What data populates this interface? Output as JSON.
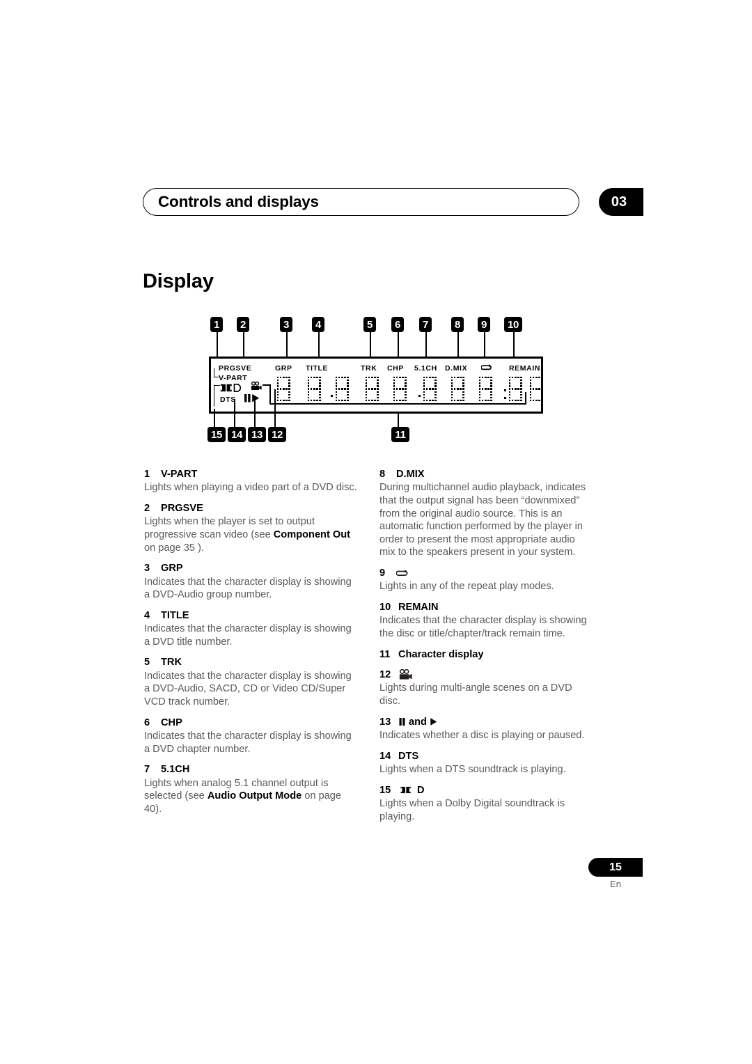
{
  "header": {
    "title": "Controls and displays",
    "chapter": "03"
  },
  "section": {
    "title": "Display"
  },
  "diagram": {
    "top_callouts": [
      "1",
      "2",
      "3",
      "4",
      "5",
      "6",
      "7",
      "8",
      "9",
      "10"
    ],
    "bottom_callouts": [
      "15",
      "14",
      "13",
      "12",
      "11"
    ],
    "panel_labels": [
      "PRGSVE",
      "V-PART",
      "GRP",
      "TITLE",
      "TRK",
      "CHP",
      "5.1CH",
      "D.MIX",
      "REMAIN",
      "DTS"
    ],
    "panel_icons": [
      "dolby-digital-icon",
      "camera-icon",
      "pause-icon",
      "play-icon",
      "repeat-icon"
    ]
  },
  "entries_left": [
    {
      "num": "1",
      "label": "V-PART",
      "body": "Lights when playing a video part of a DVD disc."
    },
    {
      "num": "2",
      "label": "PRGSVE",
      "body_pre": "Lights when the player is set to output progressive scan video (see ",
      "bold": "Component Out",
      "body_post": " on page 35 )."
    },
    {
      "num": "3",
      "label": "GRP",
      "body": "Indicates that the character display is showing a DVD-Audio group number."
    },
    {
      "num": "4",
      "label": "TITLE",
      "body": "Indicates that the character display is showing a DVD title number."
    },
    {
      "num": "5",
      "label": "TRK",
      "body": "Indicates that the character display is showing a DVD-Audio, SACD, CD or Video CD/Super VCD track number."
    },
    {
      "num": "6",
      "label": "CHP",
      "body": "Indicates that the character display is showing a DVD chapter number."
    },
    {
      "num": "7",
      "label": "5.1CH",
      "body_pre": "Lights when analog 5.1 channel output is selected (see ",
      "bold": "Audio Output Mode",
      "body_post": " on page 40)."
    }
  ],
  "entries_right": [
    {
      "num": "8",
      "label": "D.MIX",
      "body": "During multichannel audio playback, indicates that the output signal has been “downmixed” from the original audio source. This is an automatic function performed by the player in order to present the most appropriate audio mix to the speakers present in your system."
    },
    {
      "num": "9",
      "label": "",
      "icon": "repeat-icon",
      "body": "Lights in any of the repeat play modes."
    },
    {
      "num": "10",
      "label": "REMAIN",
      "body": "Indicates that the character display is showing the disc or title/chapter/track remain time."
    },
    {
      "num": "11",
      "label": "Character display",
      "body": ""
    },
    {
      "num": "12",
      "label": "",
      "icon": "camera-icon",
      "body": "Lights during multi-angle scenes on a DVD disc."
    },
    {
      "num": "13",
      "label": "and",
      "icon": "pause-play-icon",
      "body": "Indicates whether a disc is playing or paused."
    },
    {
      "num": "14",
      "label": "DTS",
      "body": "Lights when a DTS soundtrack is playing."
    },
    {
      "num": "15",
      "label": "D",
      "icon": "dolby-digital-icon",
      "body": "Lights when a Dolby Digital soundtrack is playing."
    }
  ],
  "footer": {
    "page": "15",
    "lang": "En"
  },
  "colors": {
    "ink": "#000000",
    "body_text": "#58595b",
    "background": "#ffffff"
  }
}
